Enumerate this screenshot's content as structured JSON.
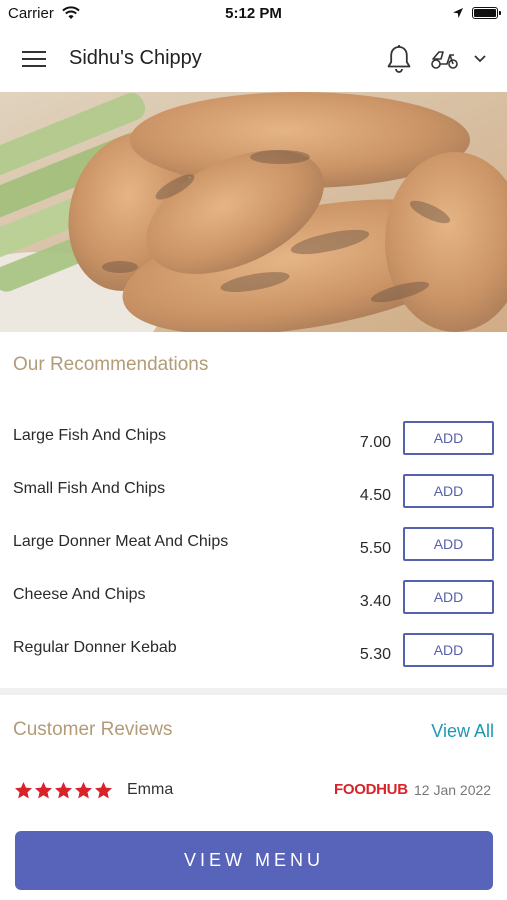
{
  "status_bar": {
    "carrier": "Carrier",
    "time": "5:12 PM"
  },
  "header": {
    "title": "Sidhu's Chippy"
  },
  "recommendations": {
    "title": "Our Recommendations",
    "add_label": "ADD",
    "items": [
      {
        "name": "Large Fish And Chips",
        "price": "7.00"
      },
      {
        "name": "Small Fish And Chips",
        "price": "4.50"
      },
      {
        "name": "Large Donner Meat And Chips",
        "price": "5.50"
      },
      {
        "name": "Cheese And Chips",
        "price": "3.40"
      },
      {
        "name": "Regular Donner Kebab",
        "price": "5.30"
      }
    ]
  },
  "reviews": {
    "title": "Customer Reviews",
    "view_all": "View All",
    "items": [
      {
        "reviewer": "Emma",
        "rating": 5,
        "source": "FOODHUB",
        "date": "12 Jan 2022"
      }
    ]
  },
  "footer": {
    "view_menu": "VIEW MENU"
  },
  "colors": {
    "accent": "#5864b9",
    "heading": "#b29c78",
    "link": "#1e98b3",
    "star": "#d8232a"
  },
  "icons": [
    "wifi-icon",
    "location-arrow-icon",
    "battery-icon",
    "hamburger-menu-icon",
    "bell-icon",
    "scooter-icon",
    "chevron-down-icon",
    "star-icon"
  ]
}
